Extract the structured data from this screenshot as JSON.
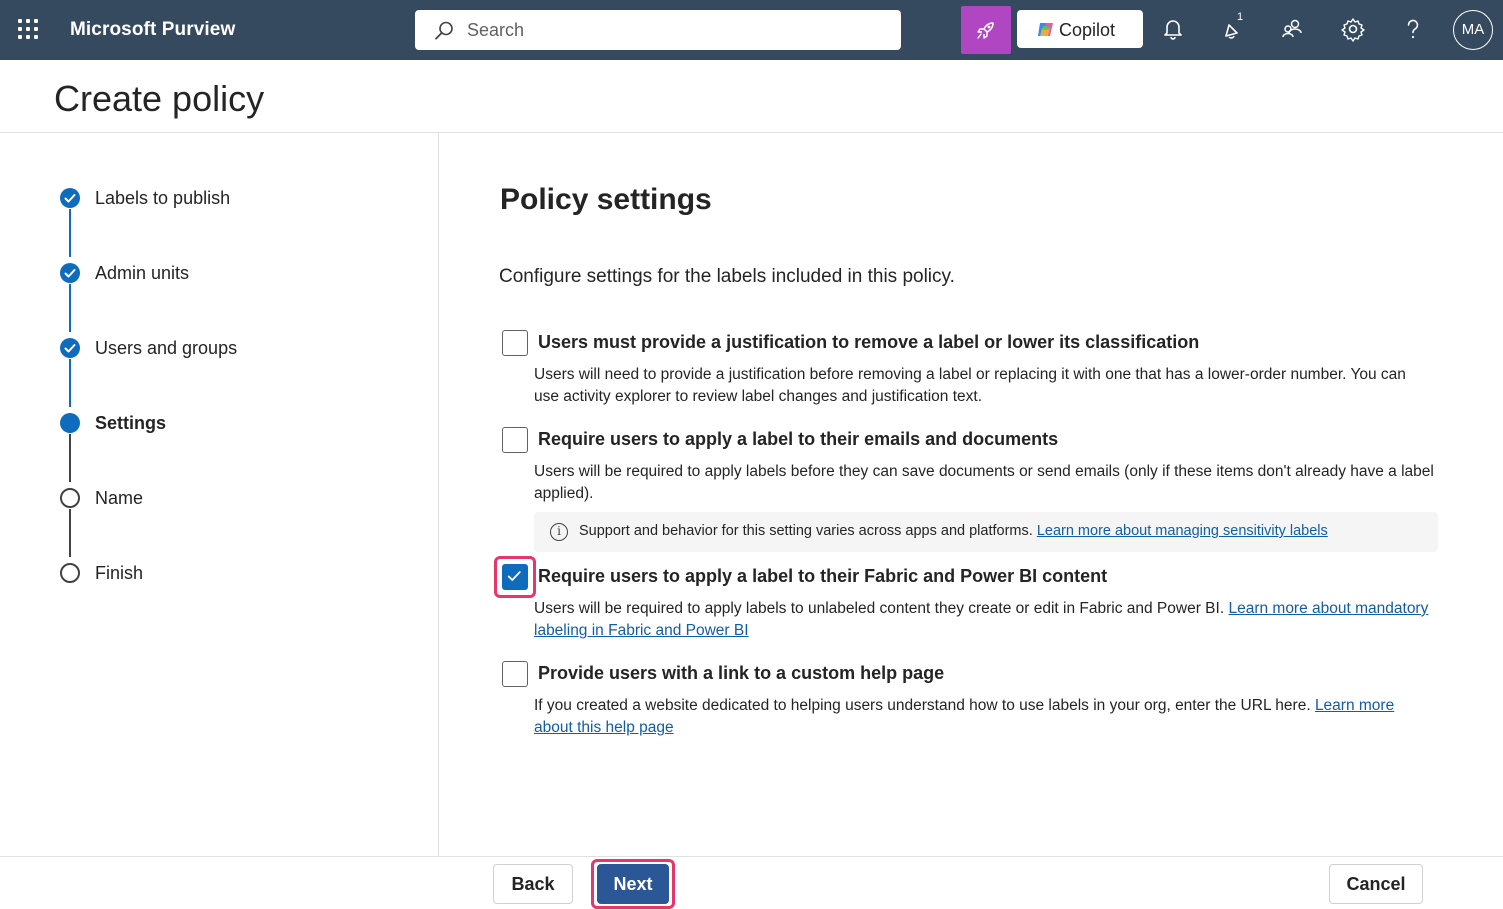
{
  "topbar": {
    "app_title": "Microsoft Purview",
    "search_placeholder": "Search",
    "copilot_label": "Copilot",
    "notification_badge": "1",
    "avatar_initials": "MA",
    "icons": [
      "waffle-icon",
      "search-icon",
      "rocket-icon",
      "copilot-logo-icon",
      "bell-icon",
      "whats-new-icon",
      "people-icon",
      "gear-icon",
      "help-icon"
    ],
    "colors": {
      "bar": "#354a5f",
      "rocket_button": "#b146c2"
    }
  },
  "page": {
    "title": "Create policy"
  },
  "steps": [
    {
      "label": "Labels to publish",
      "state": "done"
    },
    {
      "label": "Admin units",
      "state": "done"
    },
    {
      "label": "Users and groups",
      "state": "done"
    },
    {
      "label": "Settings",
      "state": "current"
    },
    {
      "label": "Name",
      "state": "todo"
    },
    {
      "label": "Finish",
      "state": "todo"
    }
  ],
  "main": {
    "section_title": "Policy settings",
    "intro": "Configure settings for the labels included in this policy.",
    "options": [
      {
        "title": "Users must provide a justification to remove a label or lower its classification",
        "description": "Users will need to provide a justification before removing a label or replacing it with one that has a lower-order number. You can use activity explorer to review label changes and justification text.",
        "checked": false
      },
      {
        "title": "Require users to apply a label to their emails and documents",
        "description": "Users will be required to apply labels before they can save documents or send emails (only if these items don't already have a label applied).",
        "info_text": "Support and behavior for this setting varies across apps and platforms.",
        "info_link": "Learn more about managing sensitivity labels",
        "checked": false
      },
      {
        "title": "Require users to apply a label to their Fabric and Power BI content",
        "description": "Users will be required to apply labels to unlabeled content they create or edit in Fabric and Power BI.",
        "link": "Learn more about mandatory labeling in Fabric and Power BI",
        "checked": true
      },
      {
        "title": "Provide users with a link to a custom help page",
        "description": "If you created a website dedicated to helping users understand how to use labels in your org, enter the URL here.",
        "link": "Learn more about this help page",
        "checked": false
      }
    ]
  },
  "footer": {
    "back_label": "Back",
    "next_label": "Next",
    "cancel_label": "Cancel"
  },
  "colors": {
    "accent": "#0f6cbd",
    "highlight": "#e7356e",
    "primary_button": "#2b5797"
  }
}
